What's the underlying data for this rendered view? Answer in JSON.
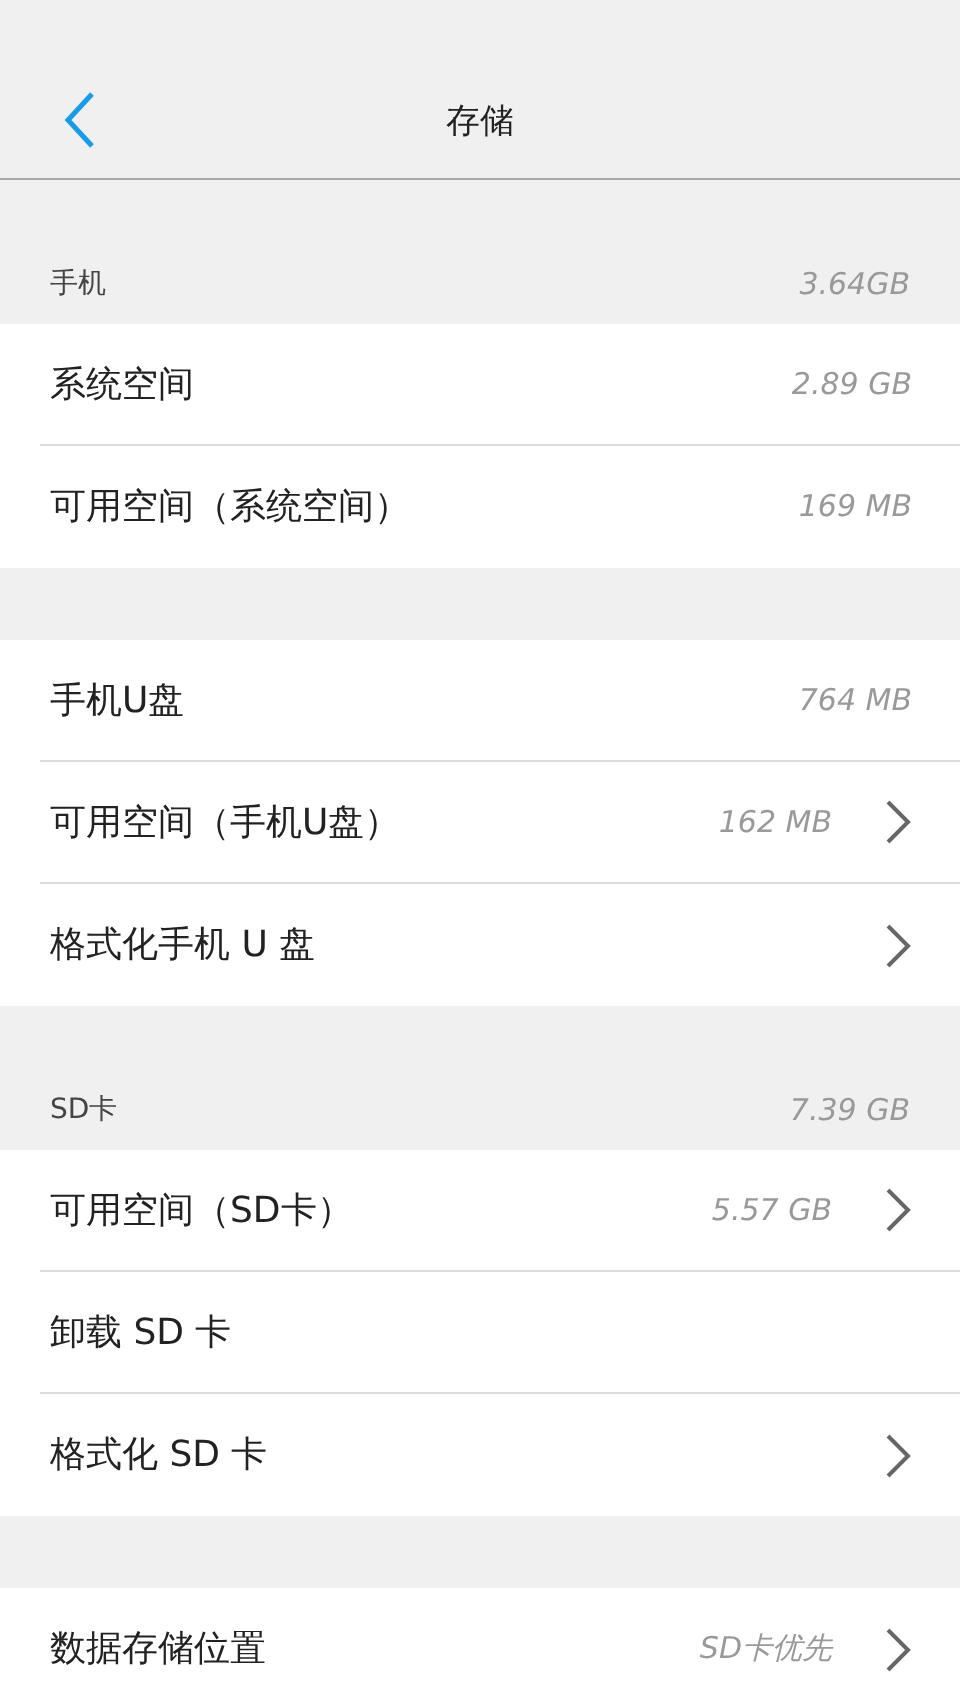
{
  "header": {
    "title": "存储"
  },
  "sections": [
    {
      "label": "手机",
      "total": "3.64GB",
      "rows": [
        {
          "label": "系统空间",
          "value": "2.89 GB",
          "chevron": false
        },
        {
          "label": "可用空间（系统空间）",
          "value": "169 MB",
          "chevron": false
        }
      ]
    },
    {
      "rows": [
        {
          "label": "手机U盘",
          "value": "764 MB",
          "chevron": false
        },
        {
          "label": "可用空间（手机U盘）",
          "value": "162 MB",
          "chevron": true
        },
        {
          "label": "格式化手机 U 盘",
          "chevron": true
        }
      ]
    },
    {
      "label": "SD卡",
      "total": "7.39 GB",
      "rows": [
        {
          "label": "可用空间（SD卡）",
          "value": "5.57 GB",
          "chevron": true
        },
        {
          "label": "卸载 SD 卡",
          "chevron": false
        },
        {
          "label": "格式化 SD 卡",
          "chevron": true
        }
      ]
    },
    {
      "rows": [
        {
          "label": "数据存储位置",
          "value": "SD卡优先",
          "chevron": true
        }
      ]
    }
  ]
}
